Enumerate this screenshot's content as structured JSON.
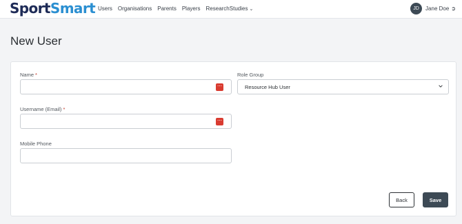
{
  "brand": {
    "part1": "Sport",
    "part2": "Smart"
  },
  "nav": {
    "links": [
      "Users",
      "Organisations",
      "Parents",
      "Players",
      "ResearchStudies"
    ]
  },
  "user": {
    "initials": "JD",
    "name": "Jane Doe"
  },
  "page": {
    "title": "New User"
  },
  "form": {
    "name_label": "Name",
    "username_label": "Username (Email)",
    "mobile_label": "Mobile Phone",
    "role_label": "Role Group",
    "role_value": "Resource Hub User",
    "required_marker": "*",
    "name_value": "",
    "username_value": "",
    "mobile_value": ""
  },
  "buttons": {
    "back": "Back",
    "save": "Save"
  },
  "colors": {
    "brand_dark": "#1e2b57",
    "brand_light": "#2b8fd1",
    "save_bg": "#3d4a55",
    "password_manager_icon": "#d93b30"
  },
  "icons": [
    "chevron-down-icon",
    "logout-icon",
    "password-manager-icon"
  ]
}
